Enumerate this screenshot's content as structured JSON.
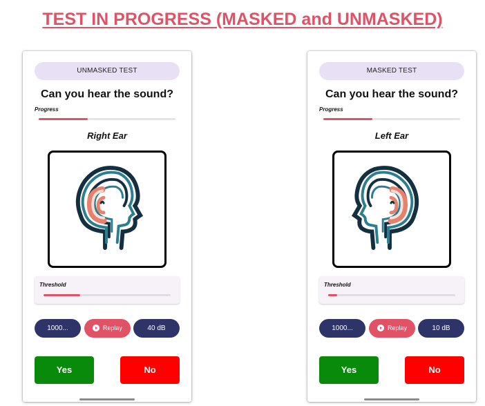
{
  "page": {
    "title": "TEST IN PROGRESS (MASKED and UNMASKED)"
  },
  "screens": [
    {
      "mode_label": "UNMASKED TEST",
      "question": "Can you hear the sound?",
      "progress_label": "Progress",
      "progress_fraction": 0.36,
      "ear_label": "Right Ear",
      "ear_side": "right",
      "threshold_label": "Threshold",
      "threshold_fraction": 0.29,
      "frequency": "1000...",
      "replay_label": "Replay",
      "level": "40 dB",
      "yes_label": "Yes",
      "no_label": "No"
    },
    {
      "mode_label": "MASKED TEST",
      "question": "Can you hear the sound?",
      "progress_label": "Progress",
      "progress_fraction": 0.36,
      "ear_label": "Left Ear",
      "ear_side": "left",
      "threshold_label": "Threshold",
      "threshold_fraction": 0.07,
      "frequency": "1000...",
      "replay_label": "Replay",
      "level": "10 dB",
      "yes_label": "Yes",
      "no_label": "No"
    }
  ],
  "colors": {
    "title": "#e05266",
    "accent": "#e05266",
    "navy": "#2e3468",
    "yes": "#0a8a0a",
    "no": "#ff0000",
    "chip": "#e8e0f5"
  },
  "icons": {
    "head": "head-with-ear-icon",
    "play": "play-circle-icon"
  }
}
